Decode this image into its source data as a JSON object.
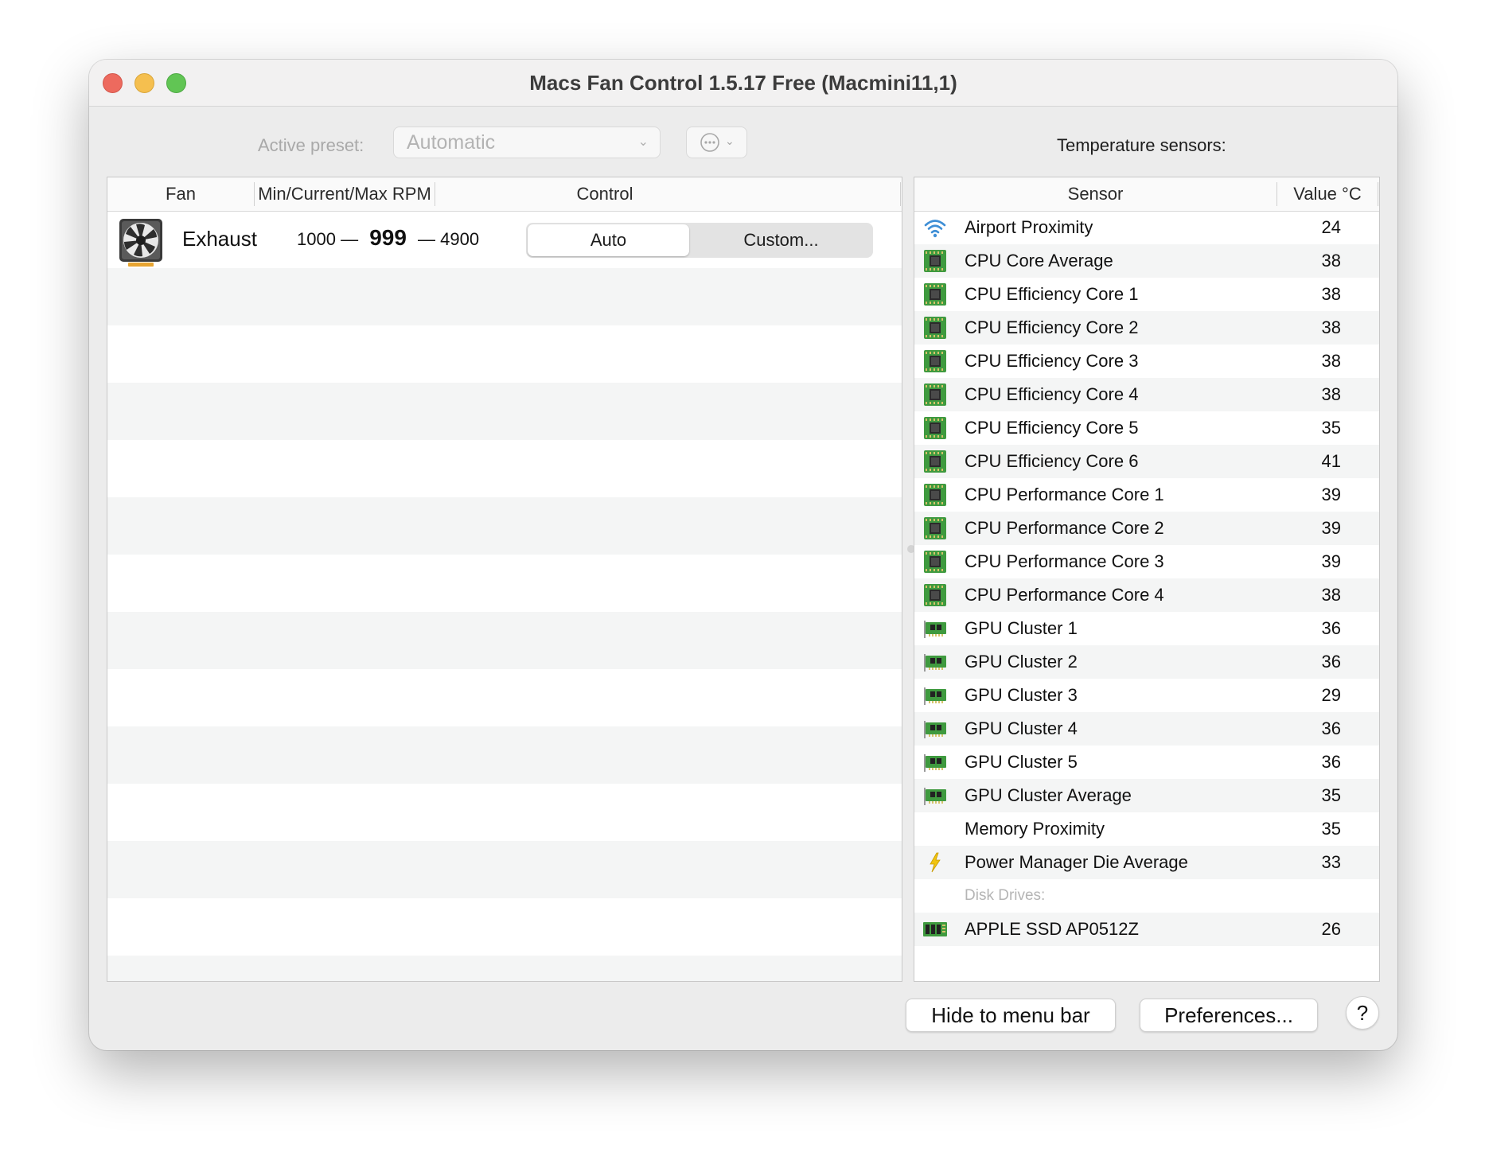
{
  "window": {
    "title": "Macs Fan Control 1.5.17 Free (Macmini11,1)"
  },
  "toolbar": {
    "preset_label": "Active preset:",
    "preset_value": "Automatic",
    "sensors_label": "Temperature sensors:"
  },
  "fan_table": {
    "columns": [
      "Fan",
      "Min/Current/Max RPM",
      "Control"
    ],
    "fans": [
      {
        "name": "Exhaust",
        "min": "1000",
        "current": "999",
        "max": "4900",
        "separator": "—",
        "control_auto": "Auto",
        "control_custom": "Custom...",
        "selected": "Auto"
      }
    ]
  },
  "sensor_table": {
    "columns": [
      "Sensor",
      "Value °C"
    ],
    "rows": [
      {
        "icon": "wifi-icon",
        "name": "Airport Proximity",
        "value": "24"
      },
      {
        "icon": "cpu-chip-icon",
        "name": "CPU Core Average",
        "value": "38"
      },
      {
        "icon": "cpu-chip-icon",
        "name": "CPU Efficiency Core 1",
        "value": "38"
      },
      {
        "icon": "cpu-chip-icon",
        "name": "CPU Efficiency Core 2",
        "value": "38"
      },
      {
        "icon": "cpu-chip-icon",
        "name": "CPU Efficiency Core 3",
        "value": "38"
      },
      {
        "icon": "cpu-chip-icon",
        "name": "CPU Efficiency Core 4",
        "value": "38"
      },
      {
        "icon": "cpu-chip-icon",
        "name": "CPU Efficiency Core 5",
        "value": "35"
      },
      {
        "icon": "cpu-chip-icon",
        "name": "CPU Efficiency Core 6",
        "value": "41"
      },
      {
        "icon": "cpu-chip-icon",
        "name": "CPU Performance Core 1",
        "value": "39"
      },
      {
        "icon": "cpu-chip-icon",
        "name": "CPU Performance Core 2",
        "value": "39"
      },
      {
        "icon": "cpu-chip-icon",
        "name": "CPU Performance Core 3",
        "value": "39"
      },
      {
        "icon": "cpu-chip-icon",
        "name": "CPU Performance Core 4",
        "value": "38"
      },
      {
        "icon": "gpu-card-icon",
        "name": "GPU Cluster 1",
        "value": "36"
      },
      {
        "icon": "gpu-card-icon",
        "name": "GPU Cluster 2",
        "value": "36"
      },
      {
        "icon": "gpu-card-icon",
        "name": "GPU Cluster 3",
        "value": "29"
      },
      {
        "icon": "gpu-card-icon",
        "name": "GPU Cluster 4",
        "value": "36"
      },
      {
        "icon": "gpu-card-icon",
        "name": "GPU Cluster 5",
        "value": "36"
      },
      {
        "icon": "gpu-card-icon",
        "name": "GPU Cluster Average",
        "value": "35"
      },
      {
        "icon": "none",
        "name": "Memory Proximity",
        "value": "35"
      },
      {
        "icon": "lightning-icon",
        "name": "Power Manager Die Average",
        "value": "33"
      },
      {
        "group": "Disk Drives:"
      },
      {
        "icon": "ssd-icon",
        "name": "APPLE SSD AP0512Z",
        "value": "26"
      }
    ]
  },
  "footer": {
    "hide_label": "Hide to menu bar",
    "preferences_label": "Preferences...",
    "help_label": "?"
  },
  "colors": {
    "close": "#ed6a5e",
    "minimize": "#f5bf4f",
    "maximize": "#61c554",
    "chip_green": "#3f9a3f",
    "wifi_blue": "#3f8fd6",
    "lightning_yellow": "#f1c40f"
  }
}
